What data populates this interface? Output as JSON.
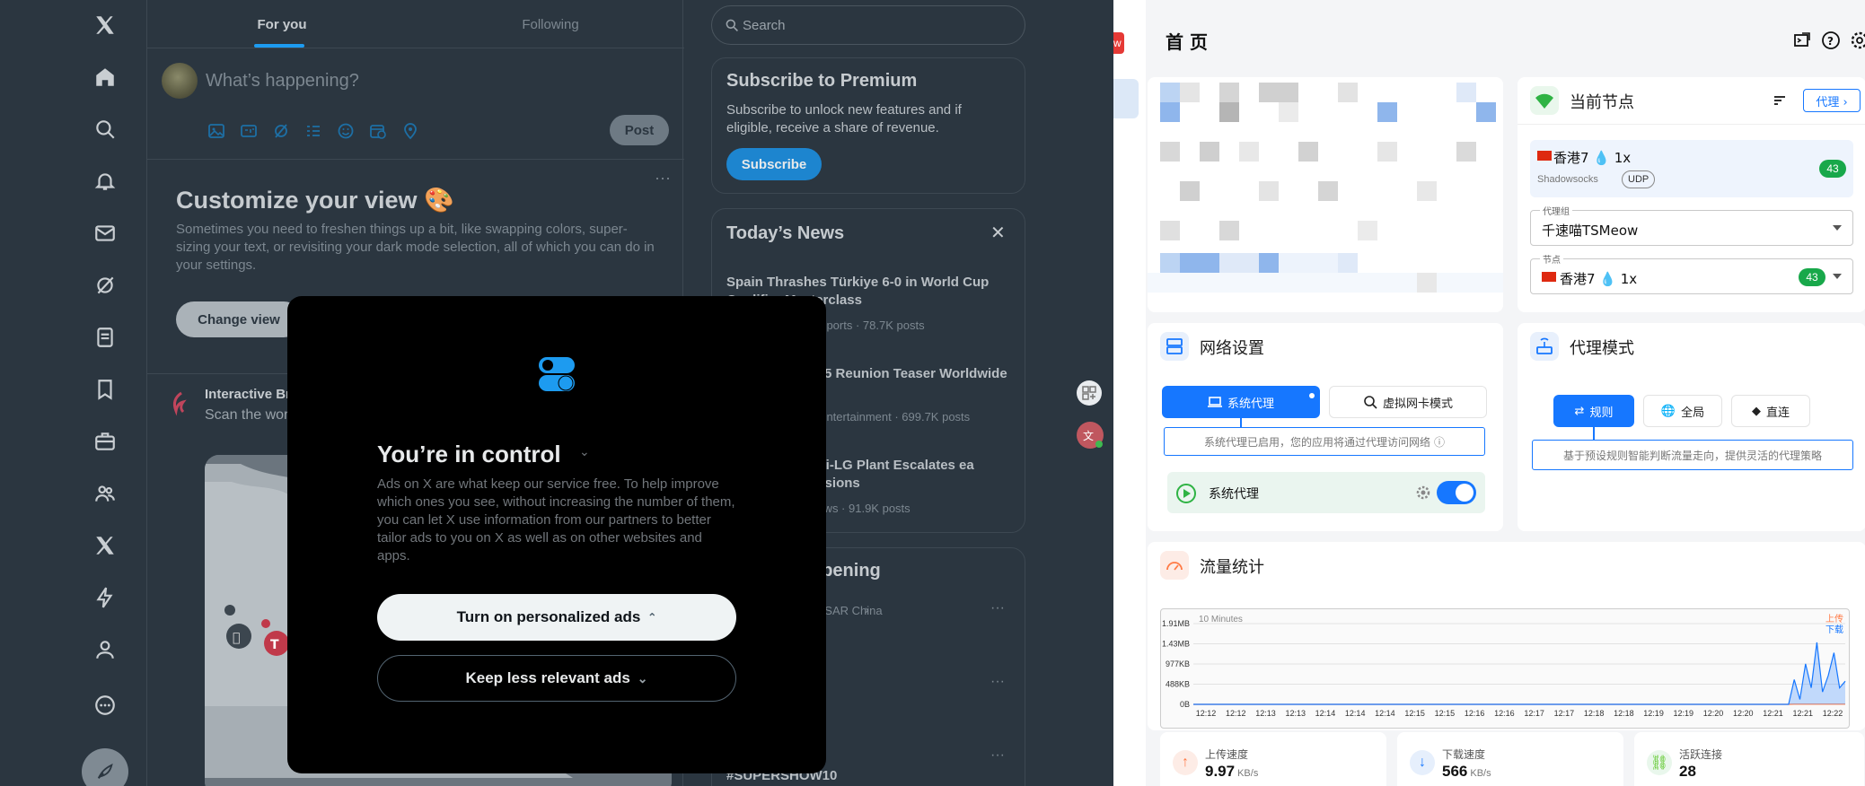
{
  "x_app": {
    "tabs": [
      "For you",
      "Following"
    ],
    "composer_placeholder": "What’s happening?",
    "post_button": "Post",
    "customize": {
      "title": "Customize your view 🎨",
      "description": "Sometimes you need to freshen things up a bit, like swapping colors, super-sizing your text, or revisiting your dark mode selection, all of which you can do in your settings.",
      "button": "Change view"
    },
    "feed_post": {
      "title": "Interactive Br",
      "text": "Scan the worl Screener at In"
    },
    "search_placeholder": "Search",
    "premium": {
      "title": "Subscribe to Premium",
      "description": "Subscribe to unlock new features and if eligible, receive a share of revenue.",
      "button": "Subscribe"
    },
    "news": {
      "title": "Today’s News",
      "items": [
        {
          "headline": "Spain Thrashes Türkiye 6-0 in World Cup Qualifier Masterclass",
          "meta": "o · Sports · 78.7K posts"
        },
        {
          "headline": "2025 Reunion Teaser Worldwide",
          "meta": "o · Entertainment · 699.7K posts"
        },
        {
          "headline": "ndai-LG Plant Escalates ea Tensions",
          "meta": "· News · 91.9K posts"
        }
      ]
    },
    "happening": {
      "title": "ppening",
      "location": "ong SAR China",
      "item2": "R",
      "item3": "#SUPERSHOW10"
    }
  },
  "modal": {
    "title": "You’re in control",
    "body": "Ads on X are what keep our service free. To help improve which ones you see, without increasing the number of them, you can let X use information from our partners to better tailor ads to you on X as well as on other websites and apps.",
    "primary_button": "Turn on personalized ads",
    "secondary_button": "Keep less relevant ads"
  },
  "clash": {
    "header_title": "首 页",
    "badge_fragment": "w",
    "current_node": {
      "title": "当前节点",
      "proxy_button": "代理 ›",
      "node_name": "香港7 💧 1x",
      "node_type": "Shadowsocks",
      "node_tag": "UDP",
      "latency": "43",
      "group_label": "代理组",
      "group_value": "千速喵TSMeow",
      "node_label": "节点",
      "node_value": "香港7 💧 1x",
      "node_latency": "43"
    },
    "network": {
      "title": "网络设置",
      "system_proxy_tab": "系统代理",
      "tun_tab": "虚拟网卡模式",
      "hint": "系统代理已启用，您的应用将通过代理访问网络",
      "toggle_label": "系统代理",
      "toggle_on": true
    },
    "proxy_mode": {
      "title": "代理模式",
      "modes": [
        "规则",
        "全局",
        "直连"
      ],
      "active": "规则",
      "hint": "基于预设规则智能判断流量走向，提供灵活的代理策略"
    },
    "traffic": {
      "title": "流量统计",
      "range_label": "10 Minutes",
      "legend_up": "上传",
      "legend_down": "下载",
      "up_color": "#ff7a45",
      "down_color": "#1677ff"
    },
    "stats": [
      {
        "label": "上传速度",
        "value": "9.97",
        "unit": "KB/s",
        "color": "#ff7a45"
      },
      {
        "label": "下载速度",
        "value": "566",
        "unit": "KB/s",
        "color": "#1677ff"
      },
      {
        "label": "活跃连接",
        "value": "28",
        "unit": "",
        "color": "#52c41a"
      }
    ]
  },
  "chart_data": {
    "type": "area",
    "title": "10 Minutes",
    "xlabel": "",
    "ylabel": "",
    "y_tick_labels": [
      "0B",
      "488KB",
      "977KB",
      "1.43MB",
      "1.91MB"
    ],
    "x_tick_labels": [
      "12:12",
      "12:12",
      "12:13",
      "12:13",
      "12:14",
      "12:14",
      "12:14",
      "12:15",
      "12:15",
      "12:16",
      "12:16",
      "12:17",
      "12:17",
      "12:18",
      "12:18",
      "12:19",
      "12:19",
      "12:20",
      "12:20",
      "12:21",
      "12:21",
      "12:22"
    ],
    "ylim_kb": [
      0,
      1956
    ],
    "series": [
      {
        "name": "上传",
        "color": "#ff7a45",
        "values": [
          0,
          0,
          0,
          0,
          0,
          0,
          0,
          0,
          0,
          0,
          0,
          0,
          0,
          0,
          0,
          0,
          0,
          0,
          0,
          0,
          0,
          0,
          0,
          0,
          0,
          0,
          0,
          0,
          0,
          0,
          0,
          0,
          0,
          0,
          0,
          0,
          0,
          0,
          0,
          0,
          0,
          0,
          0,
          0,
          0,
          0,
          0,
          0,
          0,
          0,
          0,
          0,
          0,
          0,
          0,
          0,
          0,
          0,
          0,
          0,
          0,
          0,
          0,
          0,
          0,
          0,
          0,
          0,
          0,
          0,
          0,
          0,
          0,
          0,
          0,
          0,
          0,
          0,
          0,
          0,
          0,
          0,
          0,
          0,
          0,
          0,
          0,
          0,
          0,
          0,
          0,
          0,
          0,
          0,
          0,
          0,
          0,
          0,
          0,
          0,
          0,
          0,
          0,
          0,
          0,
          0,
          5,
          5,
          5,
          5,
          5,
          5,
          5,
          5,
          5,
          5
        ]
      },
      {
        "name": "下载",
        "color": "#1677ff",
        "values": [
          0,
          0,
          0,
          0,
          0,
          0,
          0,
          0,
          0,
          0,
          0,
          0,
          0,
          0,
          0,
          0,
          0,
          0,
          0,
          0,
          0,
          0,
          0,
          0,
          0,
          0,
          0,
          0,
          0,
          0,
          0,
          0,
          0,
          0,
          0,
          0,
          0,
          0,
          0,
          0,
          0,
          0,
          0,
          0,
          0,
          0,
          0,
          0,
          0,
          0,
          0,
          0,
          0,
          0,
          0,
          0,
          0,
          0,
          0,
          0,
          0,
          0,
          0,
          0,
          0,
          0,
          0,
          0,
          0,
          0,
          0,
          0,
          0,
          0,
          0,
          0,
          0,
          0,
          0,
          0,
          0,
          0,
          0,
          0,
          0,
          0,
          0,
          0,
          0,
          0,
          0,
          0,
          0,
          0,
          0,
          0,
          0,
          0,
          0,
          0,
          0,
          0,
          0,
          0,
          0,
          0,
          600,
          120,
          980,
          400,
          1500,
          300,
          700,
          1250,
          400,
          560
        ]
      }
    ]
  }
}
